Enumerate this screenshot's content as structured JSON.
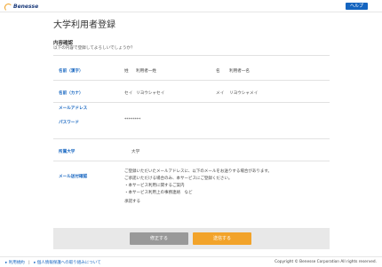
{
  "header": {
    "logo_text": "Benesse",
    "help_label": "ヘルプ"
  },
  "page": {
    "title": "大学利用者登録"
  },
  "confirm": {
    "section_title": "内容確認",
    "section_subtitle": "以下の内容で登録してよろしいでしょうか？"
  },
  "rows": {
    "name_kanji": {
      "label": "名前（漢字）",
      "sei_label": "姓",
      "sei_value": "利用者一姓",
      "mei_label": "名",
      "mei_value": "利用者一名"
    },
    "name_kana": {
      "label": "名前（カナ）",
      "sei_label": "セイ",
      "sei_value": "リヨウシャセイ",
      "mei_label": "メイ",
      "mei_value": "リヨウシャメイ"
    },
    "email": {
      "label": "メールアドレス",
      "value": ""
    },
    "password": {
      "label": "パスワード",
      "value": "********"
    },
    "university": {
      "label": "所属大学",
      "value": "大学"
    },
    "mail_consent": {
      "label": "メール送付確認",
      "lines": [
        "ご登録いただいたメールアドレスに、以下のメールをお送りする場合があります。",
        "ご承諾いただける場合のみ、本サービスにご登録ください。",
        "・本サービス利用に関するご案内",
        "・本サービス利用上の事務連絡　など",
        "承諾する"
      ]
    }
  },
  "actions": {
    "fix_label": "修正する",
    "send_label": "送信する"
  },
  "footer": {
    "terms_link": "利用規約",
    "privacy_link": "個人情報保護への取り組みについて",
    "copyright": "Copyright © Benesse Corporation All rights reserved."
  },
  "colors": {
    "accent_blue": "#1565c0",
    "send_orange": "#f2a32a",
    "fix_gray": "#999999"
  }
}
